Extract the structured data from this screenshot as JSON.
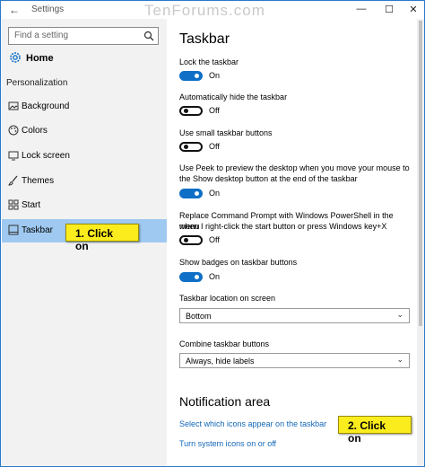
{
  "window": {
    "title": "Settings",
    "watermark": "TenForums.com"
  },
  "icons": {
    "back": "back-arrow-icon",
    "search": "search-icon",
    "home": "gear-icon"
  },
  "search": {
    "placeholder": "Find a setting"
  },
  "sidebar": {
    "home_label": "Home",
    "section_label": "Personalization",
    "items": [
      {
        "label": "Background",
        "icon": "picture-icon"
      },
      {
        "label": "Colors",
        "icon": "palette-icon"
      },
      {
        "label": "Lock screen",
        "icon": "monitor-icon"
      },
      {
        "label": "Themes",
        "icon": "brush-icon"
      },
      {
        "label": "Start",
        "icon": "grid-icon"
      },
      {
        "label": "Taskbar",
        "icon": "taskbar-icon",
        "selected": true
      }
    ]
  },
  "callouts": {
    "first": "1. Click on",
    "second": "2. Click on"
  },
  "page": {
    "title": "Taskbar",
    "settings": [
      {
        "label": "Lock the taskbar",
        "state": "On",
        "on": true
      },
      {
        "label": "Automatically hide the taskbar",
        "state": "Off",
        "on": false
      },
      {
        "label": "Use small taskbar buttons",
        "state": "Off",
        "on": false
      },
      {
        "label_line1": "Use Peek to preview the desktop when you move your mouse to",
        "label_line2": "the Show desktop button at the end of the taskbar",
        "state": "On",
        "on": true
      },
      {
        "label_line1": "Replace Command Prompt with Windows PowerShell in the menu",
        "label_line2": "when I right-click the start button or press Windows key+X",
        "state": "Off",
        "on": false
      },
      {
        "label": "Show badges on taskbar buttons",
        "state": "On",
        "on": true
      }
    ],
    "location": {
      "label": "Taskbar location on screen",
      "value": "Bottom"
    },
    "combine": {
      "label": "Combine taskbar buttons",
      "value": "Always, hide labels"
    },
    "notification": {
      "title": "Notification area",
      "link1": "Select which icons appear on the taskbar",
      "link2": "Turn system icons on or off"
    }
  },
  "colors": {
    "accent": "#0f6fc6",
    "selected_bg": "#9fc9f0",
    "callout": "#fbec1e",
    "link": "#1468b8"
  }
}
